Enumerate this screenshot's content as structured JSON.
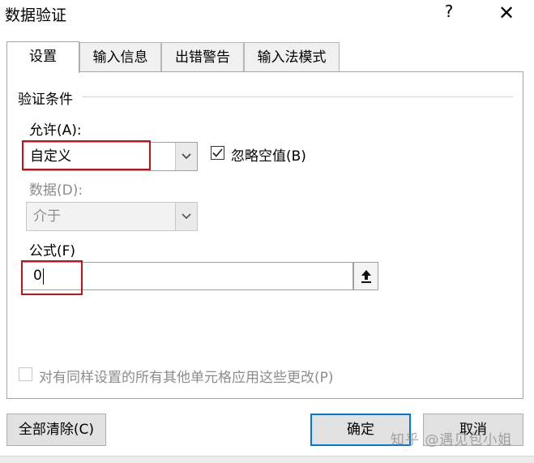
{
  "window": {
    "title": "数据验证",
    "help": "?",
    "close": "✕"
  },
  "tabs": [
    {
      "label": "设置",
      "active": true
    },
    {
      "label": "输入信息",
      "active": false
    },
    {
      "label": "出错警告",
      "active": false
    },
    {
      "label": "输入法模式",
      "active": false
    }
  ],
  "settings": {
    "group_label": "验证条件",
    "allow_label": "允许(A):",
    "allow_value": "自定义",
    "ignore_blank_label": "忽略空值(B)",
    "ignore_blank_checked": true,
    "data_label": "数据(D):",
    "data_value": "介于",
    "formula_label": "公式(F)",
    "formula_value": "0",
    "apply_all_label": "对有同样设置的所有其他单元格应用这些更改(P)",
    "apply_all_checked": false
  },
  "buttons": {
    "clear_all": "全部清除(C)",
    "ok": "确定",
    "cancel": "取消"
  },
  "watermark": "知乎 @遇见包小姐",
  "colors": {
    "highlight": "#c8101a",
    "focus": "#0078d7"
  },
  "icons": {
    "collapse_dialog": "upload-arrow-icon",
    "dropdown": "chevron-down-icon"
  }
}
